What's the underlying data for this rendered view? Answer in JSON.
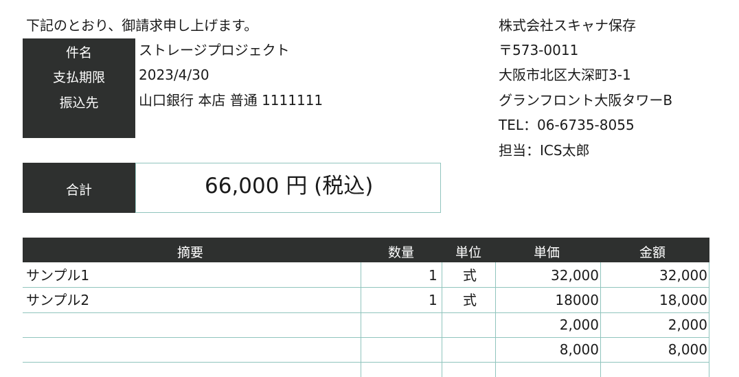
{
  "intro": "下記のとおり、御請求申し上げます。",
  "info": {
    "rows": [
      {
        "label": "件名",
        "value": "ストレージプロジェクト"
      },
      {
        "label": "支払期限",
        "value": "2023/4/30"
      },
      {
        "label": "振込先",
        "value": "山口銀行 本店 普通 1111111"
      }
    ]
  },
  "sender": {
    "company": "株式会社スキャナ保存",
    "postal": "〒573-0011",
    "address1": "大阪市北区大深町3-1",
    "address2": "グランフロント大阪タワーB",
    "tel": "TEL：06-6735-8055",
    "contact": "担当：ICS太郎"
  },
  "total": {
    "label": "合計",
    "amount": "66,000 円 (税込)"
  },
  "table": {
    "headers": [
      "摘要",
      "数量",
      "単位",
      "単価",
      "金額"
    ],
    "rows": [
      {
        "desc": "サンプル1",
        "qty": "1",
        "unit": "式",
        "price": "32,000",
        "amount": "32,000"
      },
      {
        "desc": "サンプル2",
        "qty": "1",
        "unit": "式",
        "price": "18000",
        "amount": "18,000"
      },
      {
        "desc": "",
        "qty": "",
        "unit": "",
        "price": "2,000",
        "amount": "2,000"
      },
      {
        "desc": "",
        "qty": "",
        "unit": "",
        "price": "8,000",
        "amount": "8,000"
      }
    ]
  }
}
